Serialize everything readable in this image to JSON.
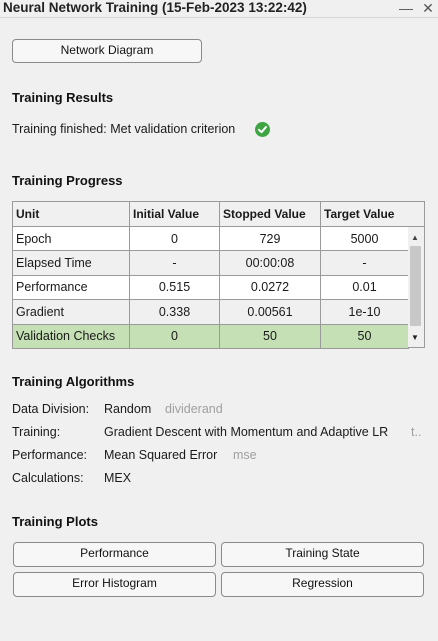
{
  "window": {
    "title": "Neural Network Training (15-Feb-2023 13:22:42)",
    "minimize_glyph": "—",
    "close_glyph": "✕"
  },
  "buttons": {
    "network_diagram": "Network Diagram"
  },
  "results": {
    "heading": "Training Results",
    "status": "Training finished: Met validation criterion"
  },
  "progress": {
    "heading": "Training Progress",
    "columns": [
      "Unit",
      "Initial Value",
      "Stopped Value",
      "Target Value"
    ],
    "rows": [
      [
        "Epoch",
        "0",
        "729",
        "5000"
      ],
      [
        "Elapsed Time",
        "-",
        "00:00:08",
        "-"
      ],
      [
        "Performance",
        "0.515",
        "0.0272",
        "0.01"
      ],
      [
        "Gradient",
        "0.338",
        "0.00561",
        "1e-10"
      ],
      [
        "Validation Checks",
        "0",
        "50",
        "50"
      ]
    ]
  },
  "algorithms": {
    "heading": "Training Algorithms",
    "data_division": {
      "label": "Data Division:",
      "value": "Random",
      "fn": "dividerand"
    },
    "training": {
      "label": "Training:",
      "value": "Gradient Descent with Momentum and Adaptive LR",
      "fn": "t.."
    },
    "performance": {
      "label": "Performance:",
      "value": "Mean Squared Error",
      "fn": "mse"
    },
    "calculations": {
      "label": "Calculations:",
      "value": "MEX"
    }
  },
  "plots": {
    "heading": "Training Plots",
    "performance": "Performance",
    "training_state": "Training State",
    "error_histogram": "Error Histogram",
    "regression": "Regression"
  },
  "colors": {
    "highlight_row": "#c5e0b4",
    "success_icon": "#3fa543"
  }
}
